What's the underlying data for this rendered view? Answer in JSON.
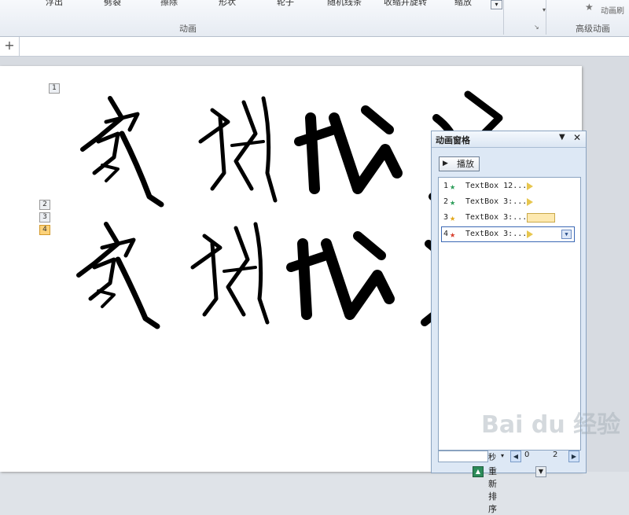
{
  "ribbon": {
    "top_labels": [
      "浮出",
      "劈裂",
      "擦除",
      "形状",
      "轮子",
      "随机线条",
      "收缩并旋转",
      "缩放"
    ],
    "group_animation": "动画",
    "group_advanced": "高级动画",
    "animation_brush": "动画刷"
  },
  "tags": [
    "1",
    "2",
    "3",
    "4"
  ],
  "pane": {
    "title": "动画窗格",
    "menu_arrow": "▼",
    "close": "✕",
    "play_label": "播放",
    "items": [
      {
        "num": "1",
        "text": "TextBox 12...",
        "star_color": "#2e9e5b"
      },
      {
        "num": "2",
        "text": "TextBox 3:...",
        "star_color": "#2e9e5b"
      },
      {
        "num": "3",
        "text": "TextBox 3:...",
        "star_color": "#e3a719"
      },
      {
        "num": "4",
        "text": "TextBox 3:...",
        "star_color": "#d8412f"
      }
    ],
    "timeline_unit": "秒",
    "timeline_start": "0",
    "timeline_end": "2",
    "reorder_label": "重新排序"
  },
  "watermark": "Bai du 经验",
  "colors": {
    "selection": "#3b68b5",
    "pane_bg": "#dde8f5"
  }
}
